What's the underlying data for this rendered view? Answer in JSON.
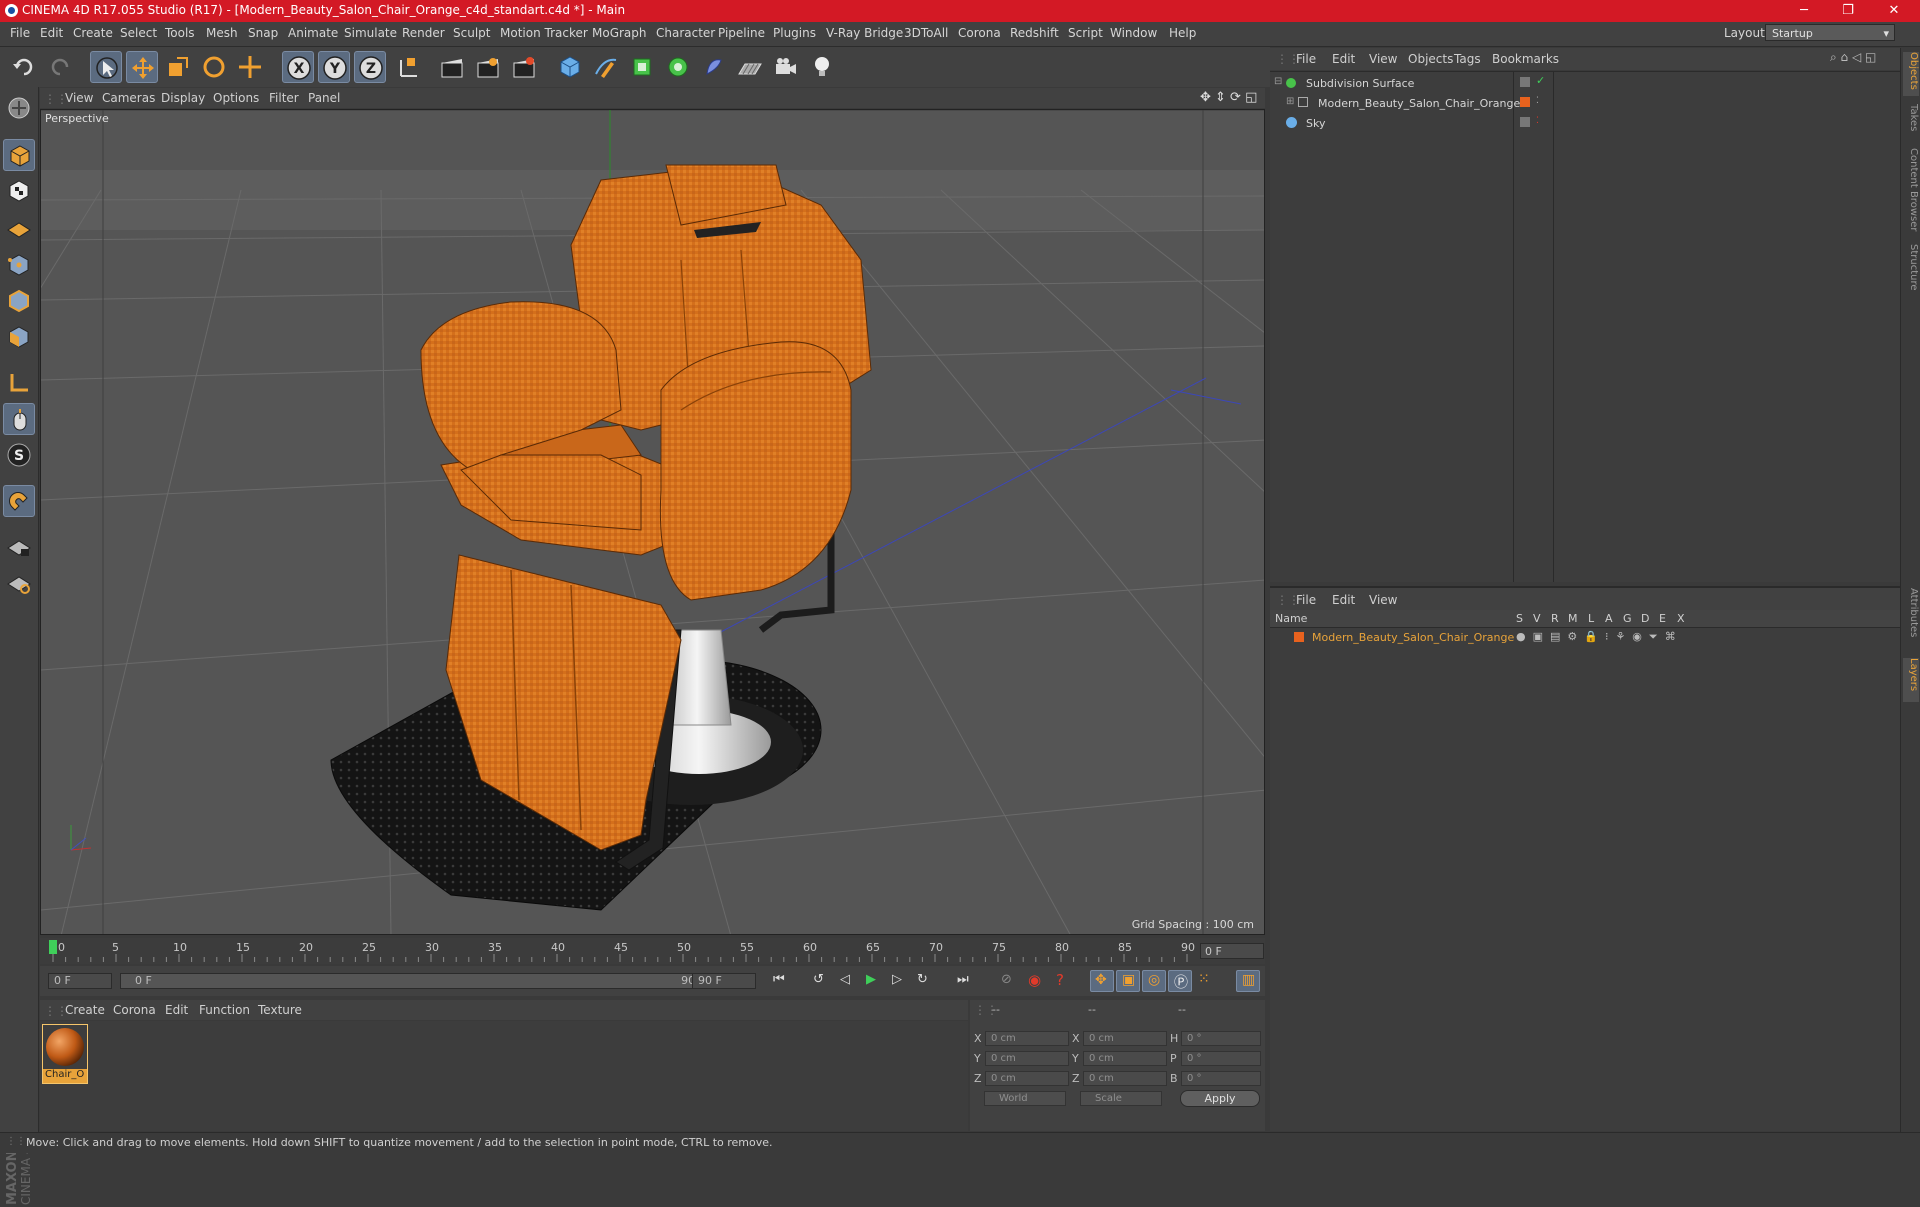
{
  "window": {
    "title": "CINEMA 4D R17.055 Studio (R17) - [Modern_Beauty_Salon_Chair_Orange_c4d_standart.c4d *] - Main"
  },
  "menubar": {
    "items": [
      "File",
      "Edit",
      "Create",
      "Select",
      "Tools",
      "Mesh",
      "Snap",
      "Animate",
      "Simulate",
      "Render",
      "Sculpt",
      "Motion Tracker",
      "MoGraph",
      "Character",
      "Pipeline",
      "Plugins",
      "V-Ray Bridge",
      "3DToAll",
      "Corona",
      "Redshift",
      "Script",
      "Window",
      "Help"
    ],
    "layout_label": "Layout:",
    "layout_value": "Startup"
  },
  "viewport": {
    "menu": [
      "View",
      "Cameras",
      "Display",
      "Options",
      "Filter",
      "Panel"
    ],
    "label": "Perspective",
    "grid_spacing": "Grid Spacing : 100 cm"
  },
  "timeline": {
    "ticks": [
      "0",
      "5",
      "10",
      "15",
      "20",
      "25",
      "30",
      "35",
      "40",
      "45",
      "50",
      "55",
      "60",
      "65",
      "70",
      "75",
      "80",
      "85",
      "90"
    ],
    "current_frame": "0 F",
    "start_field": "0 F",
    "range_start": "0 F",
    "range_end": "90 F",
    "end_field": "90 F"
  },
  "material_manager": {
    "menu": [
      "Create",
      "Corona",
      "Edit",
      "Function",
      "Texture"
    ],
    "materials": [
      {
        "name": "Chair_O"
      }
    ]
  },
  "coordinates": {
    "header": [
      "--",
      "--",
      "--"
    ],
    "rows": [
      {
        "a": "X",
        "av": "0 cm",
        "b": "X",
        "bv": "0 cm",
        "c": "H",
        "cv": "0 °"
      },
      {
        "a": "Y",
        "av": "0 cm",
        "b": "Y",
        "bv": "0 cm",
        "c": "P",
        "cv": "0 °"
      },
      {
        "a": "Z",
        "av": "0 cm",
        "b": "Z",
        "bv": "0 cm",
        "c": "B",
        "cv": "0 °"
      }
    ],
    "mode_world": "World",
    "mode_scale": "Scale",
    "apply": "Apply"
  },
  "object_manager": {
    "menu": [
      "File",
      "Edit",
      "View",
      "Objects",
      "Tags",
      "Bookmarks"
    ],
    "objects": [
      {
        "name": "Subdivision Surface"
      },
      {
        "name": "Modern_Beauty_Salon_Chair_Orange"
      },
      {
        "name": "Sky"
      }
    ]
  },
  "layer_manager": {
    "menu": [
      "File",
      "Edit",
      "View"
    ],
    "columns": [
      "Name",
      "S",
      "V",
      "R",
      "M",
      "L",
      "A",
      "G",
      "D",
      "E",
      "X"
    ],
    "layers": [
      {
        "name": "Modern_Beauty_Salon_Chair_Orange"
      }
    ]
  },
  "right_tabs": [
    "Objects",
    "Takes",
    "Content Browser",
    "Structure",
    "Attributes",
    "Layers"
  ],
  "status": {
    "text": "Move: Click and drag to move elements. Hold down SHIFT to quantize movement / add to the selection in point mode, CTRL to remove."
  },
  "colors": {
    "accent_orange": "#e8a33a",
    "chair_orange": "#d9741e",
    "title_red": "#d31925",
    "selection_blue": "#5b6b80"
  }
}
